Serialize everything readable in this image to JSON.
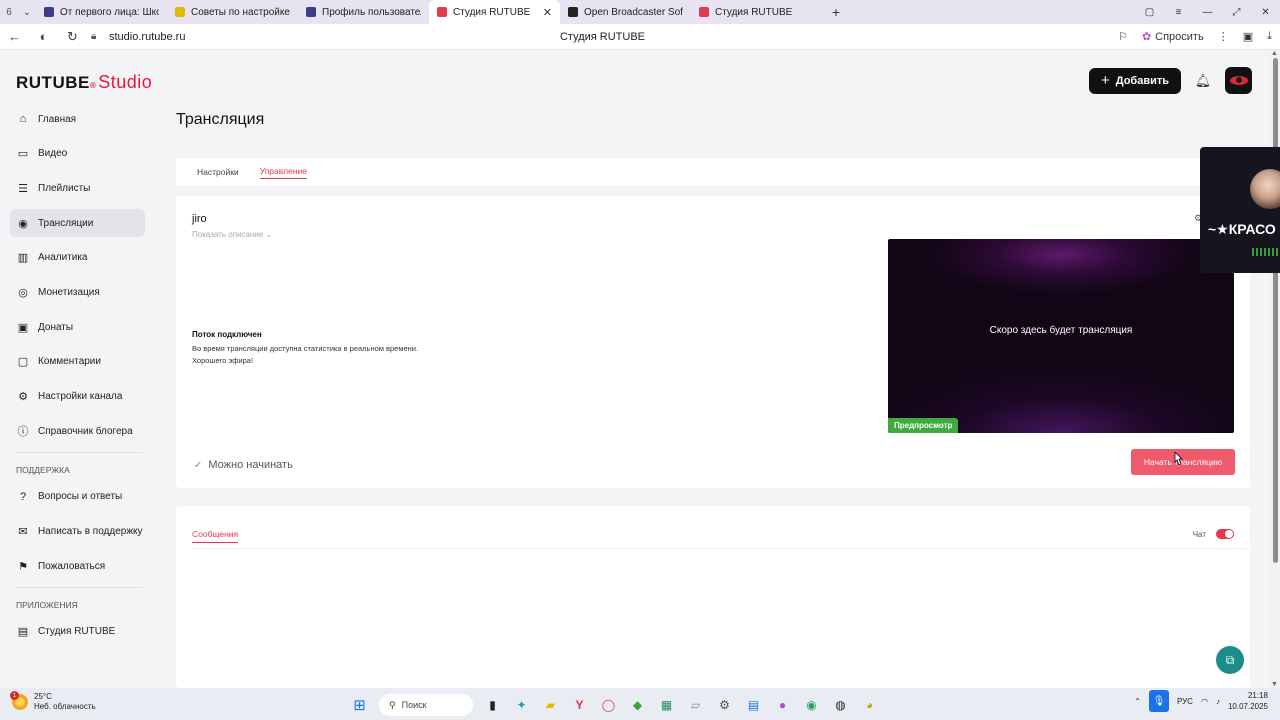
{
  "browser": {
    "tabs": [
      {
        "title": "От первого лица: Школа",
        "color": "#3d3d8a",
        "active": false
      },
      {
        "title": "Советы по настройке для",
        "color": "#e5b800",
        "active": false
      },
      {
        "title": "Профиль пользователя с",
        "color": "#3d3d8a",
        "active": false
      },
      {
        "title": "Студия RUTUBE",
        "color": "#e23b4e",
        "active": true
      },
      {
        "title": "Open Broadcaster Softwa",
        "color": "#222222",
        "active": false
      },
      {
        "title": "Студия RUTUBE",
        "color": "#e23b4e",
        "active": false
      }
    ],
    "tab_count": "6",
    "url": "studio.rutube.ru",
    "page_title": "Студия RUTUBE",
    "ask_label": "Спросить"
  },
  "app": {
    "logo_main": "RUTUBE",
    "logo_sub": "Studio",
    "add_label": "Добавить",
    "sidebar": {
      "items": [
        {
          "label": "Главная",
          "icon": "home-icon",
          "glyph": "⌂"
        },
        {
          "label": "Видео",
          "icon": "video-icon",
          "glyph": "▭"
        },
        {
          "label": "Плейлисты",
          "icon": "playlist-icon",
          "glyph": "☰"
        },
        {
          "label": "Трансляции",
          "icon": "broadcast-icon",
          "glyph": "◉"
        },
        {
          "label": "Аналитика",
          "icon": "analytics-icon",
          "glyph": "▥"
        },
        {
          "label": "Монетизация",
          "icon": "monetization-icon",
          "glyph": "◎"
        },
        {
          "label": "Донаты",
          "icon": "donations-icon",
          "glyph": "▣"
        },
        {
          "label": "Комментарии",
          "icon": "comments-icon",
          "glyph": "▢"
        },
        {
          "label": "Настройки канала",
          "icon": "settings-icon",
          "glyph": "⚙"
        },
        {
          "label": "Справочник блогера",
          "icon": "help-icon",
          "glyph": "ⓘ"
        }
      ],
      "support_title": "ПОДДЕРЖКА",
      "support_items": [
        {
          "label": "Вопросы и ответы",
          "icon": "faq-icon",
          "glyph": "?"
        },
        {
          "label": "Написать в поддержку",
          "icon": "mail-icon",
          "glyph": "✉"
        },
        {
          "label": "Пожаловаться",
          "icon": "flag-icon",
          "glyph": "⚑"
        }
      ],
      "apps_title": "ПРИЛОЖЕНИЯ",
      "apps_items": [
        {
          "label": "Студия RUTUBE",
          "icon": "studio-app-icon",
          "glyph": "▤"
        }
      ]
    },
    "page_title": "Трансляция",
    "tabs": {
      "settings": "Настройки",
      "management": "Управление"
    },
    "stream": {
      "name": "jiro",
      "show_description": "Показать описание",
      "status_title": "Поток подключен",
      "status_text_1": "Во время трансляции доступна статистика в реальном времени.",
      "status_text_2": "Хорошего эфира!",
      "ready": "Можно начинать",
      "preview_text": "Скоро здесь будет трансляция",
      "preview_badge": "Предпросмотр",
      "start_button": "Начать трансляцию"
    },
    "messages": {
      "tab": "Сообщения",
      "chat_label": "Чат"
    }
  },
  "obs_overlay": {
    "text": "~★КРАСО"
  },
  "taskbar": {
    "weather_temp": "25°C",
    "weather_desc": "Неб. облачность",
    "search_label": "Поиск",
    "lang": "РУС",
    "time": "21:18",
    "date": "10.07.2025"
  }
}
